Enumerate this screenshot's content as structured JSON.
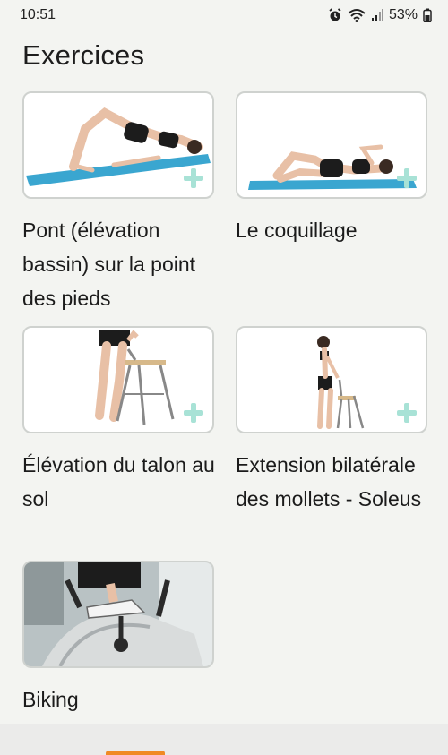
{
  "status_bar": {
    "time": "10:51",
    "battery": "53%",
    "icons": [
      "alarm-icon",
      "wifi-icon",
      "signal-icon",
      "battery-icon"
    ]
  },
  "page": {
    "title": "Exercices"
  },
  "exercises": [
    {
      "title": "Pont (élévation bassin) sur la point des pieds",
      "icon": "plus-icon"
    },
    {
      "title": "Le coquillage",
      "icon": "plus-icon"
    },
    {
      "title": "Élévation du talon au sol",
      "icon": "plus-icon"
    },
    {
      "title": "Extension bilatérale des mollets - Soleus",
      "icon": "plus-icon"
    },
    {
      "title": "Biking"
    }
  ],
  "colors": {
    "background": "#f3f4f1",
    "card_border": "#cfd2cf",
    "plus_icon": "#a8e2d6",
    "mat": "#3aa6d0"
  }
}
